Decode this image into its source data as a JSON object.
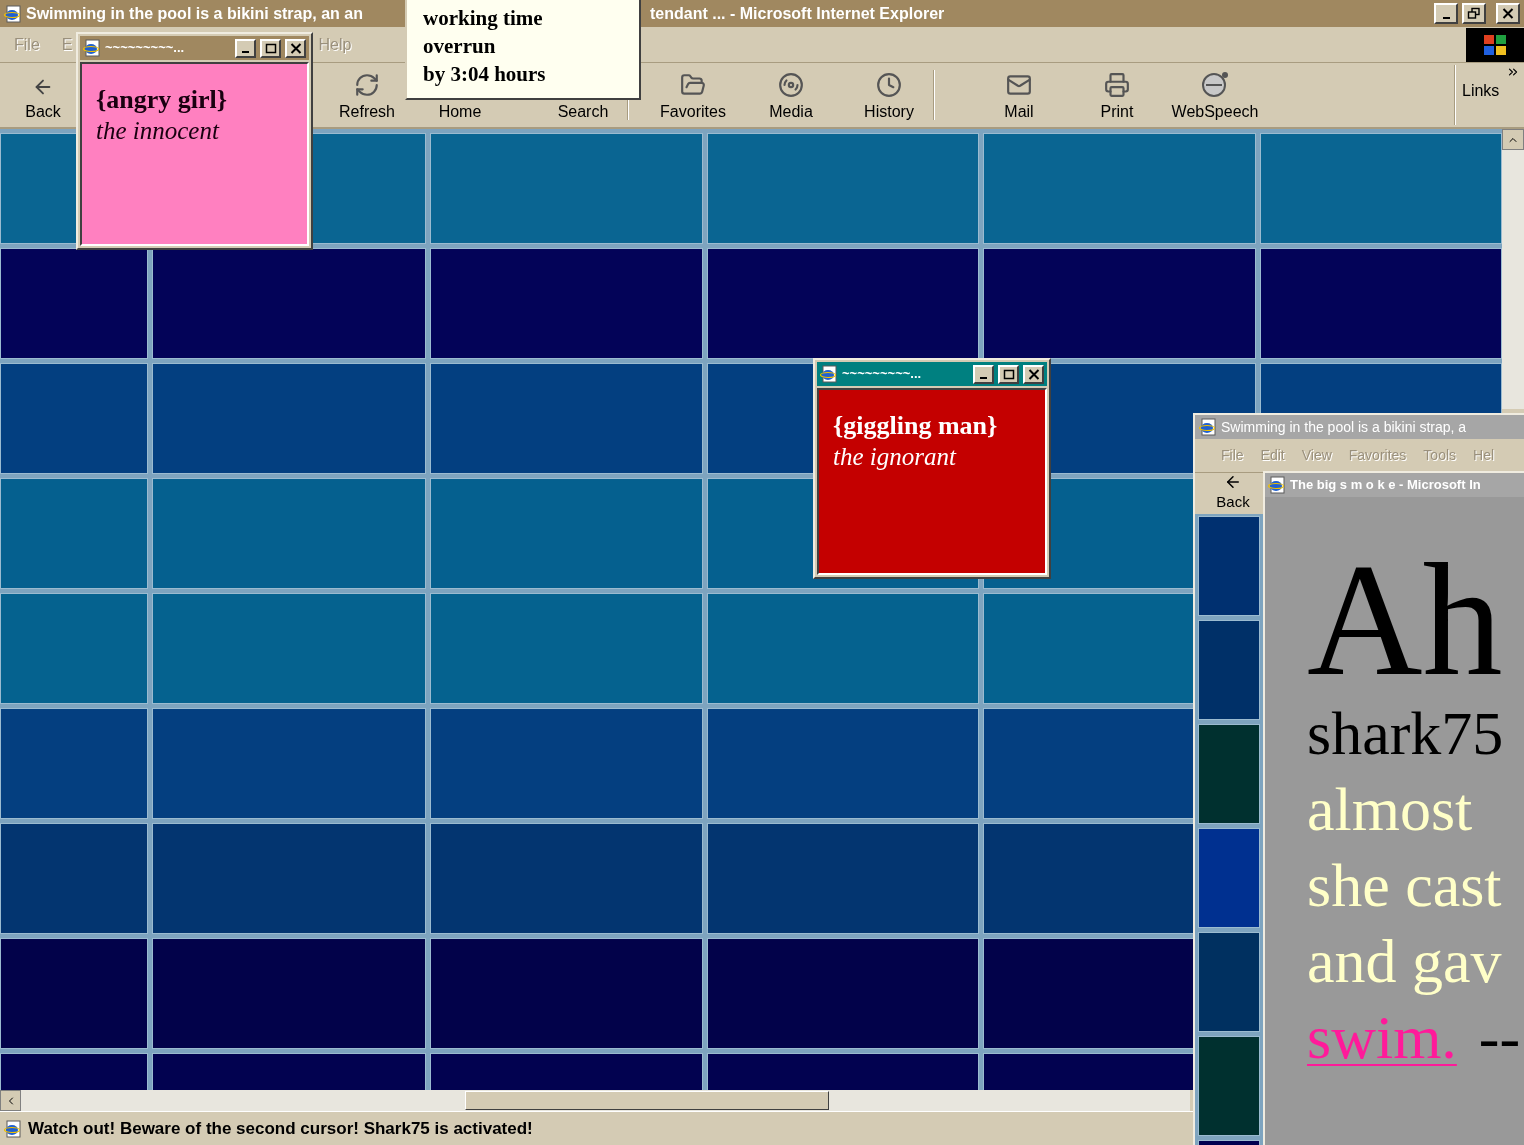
{
  "main_window": {
    "title_parts": [
      "Swimming in the pool is a bikini strap, an an",
      "tendant ... - Microsoft Internet Explorer"
    ],
    "menu": [
      {
        "label": "File",
        "disabled": true
      },
      {
        "label": "E",
        "disabled": true
      },
      {
        "label": "Help",
        "disabled": true
      }
    ],
    "toolbar": [
      {
        "label": "Back",
        "kind": "back"
      },
      {
        "label": "Refresh",
        "kind": "refresh"
      },
      {
        "label": "Home",
        "kind": "covered"
      },
      {
        "label": "Search",
        "kind": "covered"
      },
      {
        "label": "Favorites",
        "kind": "favorites"
      },
      {
        "label": "Media",
        "kind": "media"
      },
      {
        "label": "History",
        "kind": "history"
      },
      {
        "label": "Mail",
        "kind": "mail"
      },
      {
        "label": "Print",
        "kind": "print"
      },
      {
        "label": "WebSpeech",
        "kind": "speech"
      }
    ],
    "links": "Links",
    "status": "Watch out! Beware of the second cursor! Shark75 is activated!"
  },
  "tooltip": {
    "lines": [
      "working time",
      "overrun",
      "by 3:04 hours"
    ]
  },
  "popups": [
    {
      "title": "~~~~~~~~~...",
      "heading": "{angry girl}",
      "subtitle": "the innocent",
      "color": "#ff80c0",
      "kind": "light"
    },
    {
      "title": "~~~~~~~~~...",
      "heading": "{giggling man}",
      "subtitle": "the ignorant",
      "color": "#c40000",
      "kind": "dark"
    }
  ],
  "second_window": {
    "title": "Swimming in the pool is a bikini strap, a",
    "menu": [
      {
        "label": "File",
        "disabled": true
      },
      {
        "label": "Edit",
        "disabled": true
      },
      {
        "label": "View",
        "disabled": true
      },
      {
        "label": "Favorites",
        "disabled": true
      },
      {
        "label": "Tools",
        "disabled": true
      },
      {
        "label": "Hel",
        "disabled": true
      }
    ],
    "back": "Back",
    "inner_window": {
      "title": "The big s m o k e - Microsoft In",
      "heading": "Ah",
      "lines": [
        [
          {
            "text": "shark75",
            "kind": "plain"
          }
        ],
        [
          {
            "text": "almost",
            "kind": "light"
          }
        ],
        [
          {
            "text": "she cast",
            "kind": "light"
          }
        ],
        [
          {
            "text": "and gav",
            "kind": "light"
          }
        ],
        [
          {
            "text": "swim.",
            "kind": "link"
          },
          {
            "text": "--",
            "kind": "plain"
          }
        ]
      ]
    }
  }
}
